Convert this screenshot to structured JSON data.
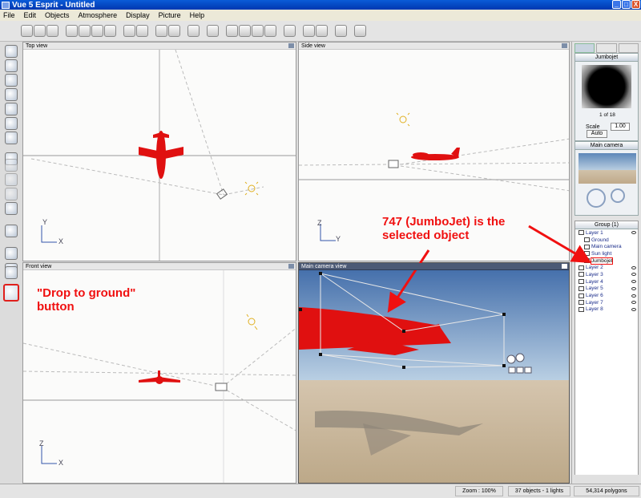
{
  "window": {
    "title": "Vue 5 Esprit - Untitled",
    "minimize": "_",
    "maximize": "□",
    "close": "X"
  },
  "menu": [
    "File",
    "Edit",
    "Objects",
    "Atmosphere",
    "Display",
    "Picture",
    "Help"
  ],
  "views": {
    "top": {
      "title": "Top view",
      "axis_v": "Y",
      "axis_h": "X"
    },
    "side": {
      "title": "Side view",
      "axis_v": "Z",
      "axis_h": "Y"
    },
    "front": {
      "title": "Front view",
      "axis_v": "Z",
      "axis_h": "X"
    },
    "camera": {
      "title": "Main camera view"
    }
  },
  "right_panel": {
    "material_name": "Jumbojet",
    "material_nav": "1 of 18",
    "scale_label": "Scale",
    "scale_value": "1.00",
    "auto_label": "Auto",
    "camera_title": "Main camera",
    "group_title": "Group (1)",
    "layers": [
      {
        "label": "Layer 1",
        "level": 0,
        "checked": true
      },
      {
        "label": "Ground",
        "level": 1,
        "checked": false
      },
      {
        "label": "Main camera",
        "level": 1,
        "checked": false
      },
      {
        "label": "Sun light",
        "level": 1,
        "checked": false
      },
      {
        "label": "Jumbojet",
        "level": 1,
        "checked": false,
        "selected": true
      },
      {
        "label": "Layer 2",
        "level": 0,
        "checked": true
      },
      {
        "label": "Layer 3",
        "level": 0,
        "checked": true
      },
      {
        "label": "Layer 4",
        "level": 0,
        "checked": true
      },
      {
        "label": "Layer 5",
        "level": 0,
        "checked": true
      },
      {
        "label": "Layer 6",
        "level": 0,
        "checked": true
      },
      {
        "label": "Layer 7",
        "level": 0,
        "checked": true
      },
      {
        "label": "Layer 8",
        "level": 0,
        "checked": true
      }
    ]
  },
  "status": {
    "zoom": "Zoom : 100%",
    "objects": "37 objects - 1 lights",
    "polygons": "54,314 polygons"
  },
  "annotations": {
    "drop_line1": "\"Drop to ground\"",
    "drop_line2": "button",
    "jumbo_line1": "747 (JumboJet) is the",
    "jumbo_line2": "selected object"
  },
  "colors": {
    "annotation": "#f01010",
    "plane": "#e01010",
    "sky": "#5b86b8",
    "ground": "#c9b9a0"
  }
}
